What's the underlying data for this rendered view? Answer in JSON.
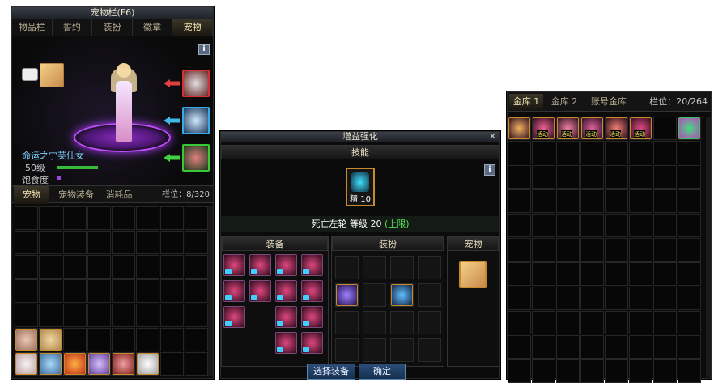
{
  "pet_window": {
    "title": "宠物栏(F6)",
    "tabs": [
      "物品栏",
      "誓约",
      "装扮",
      "徽章",
      "宠物"
    ],
    "pet_name": "命运之宁芙仙女",
    "level": "50级",
    "satiety_label": "饱食度",
    "info_icon": "i",
    "bottom_tabs": [
      "宠物",
      "宠物装备",
      "消耗品"
    ],
    "slots_label": "栏位：8/320",
    "accent": "#7a35c8"
  },
  "enhance_window": {
    "title": "增益强化",
    "skill_header": "技能",
    "skill_level_badge": "精 10",
    "skill_line_name": "死亡左轮 等级 20",
    "skill_line_limit": "(上限)",
    "info_icon": "i",
    "col_equip": "装备",
    "col_avatar": "装扮",
    "col_pet": "宠物",
    "select_button": "选择装备",
    "confirm_button": "确定"
  },
  "storage_window": {
    "tabs": [
      "金库 1",
      "金库 2",
      "账号金库"
    ],
    "slots_label": "栏位：20/264",
    "item_tag": "活动"
  }
}
